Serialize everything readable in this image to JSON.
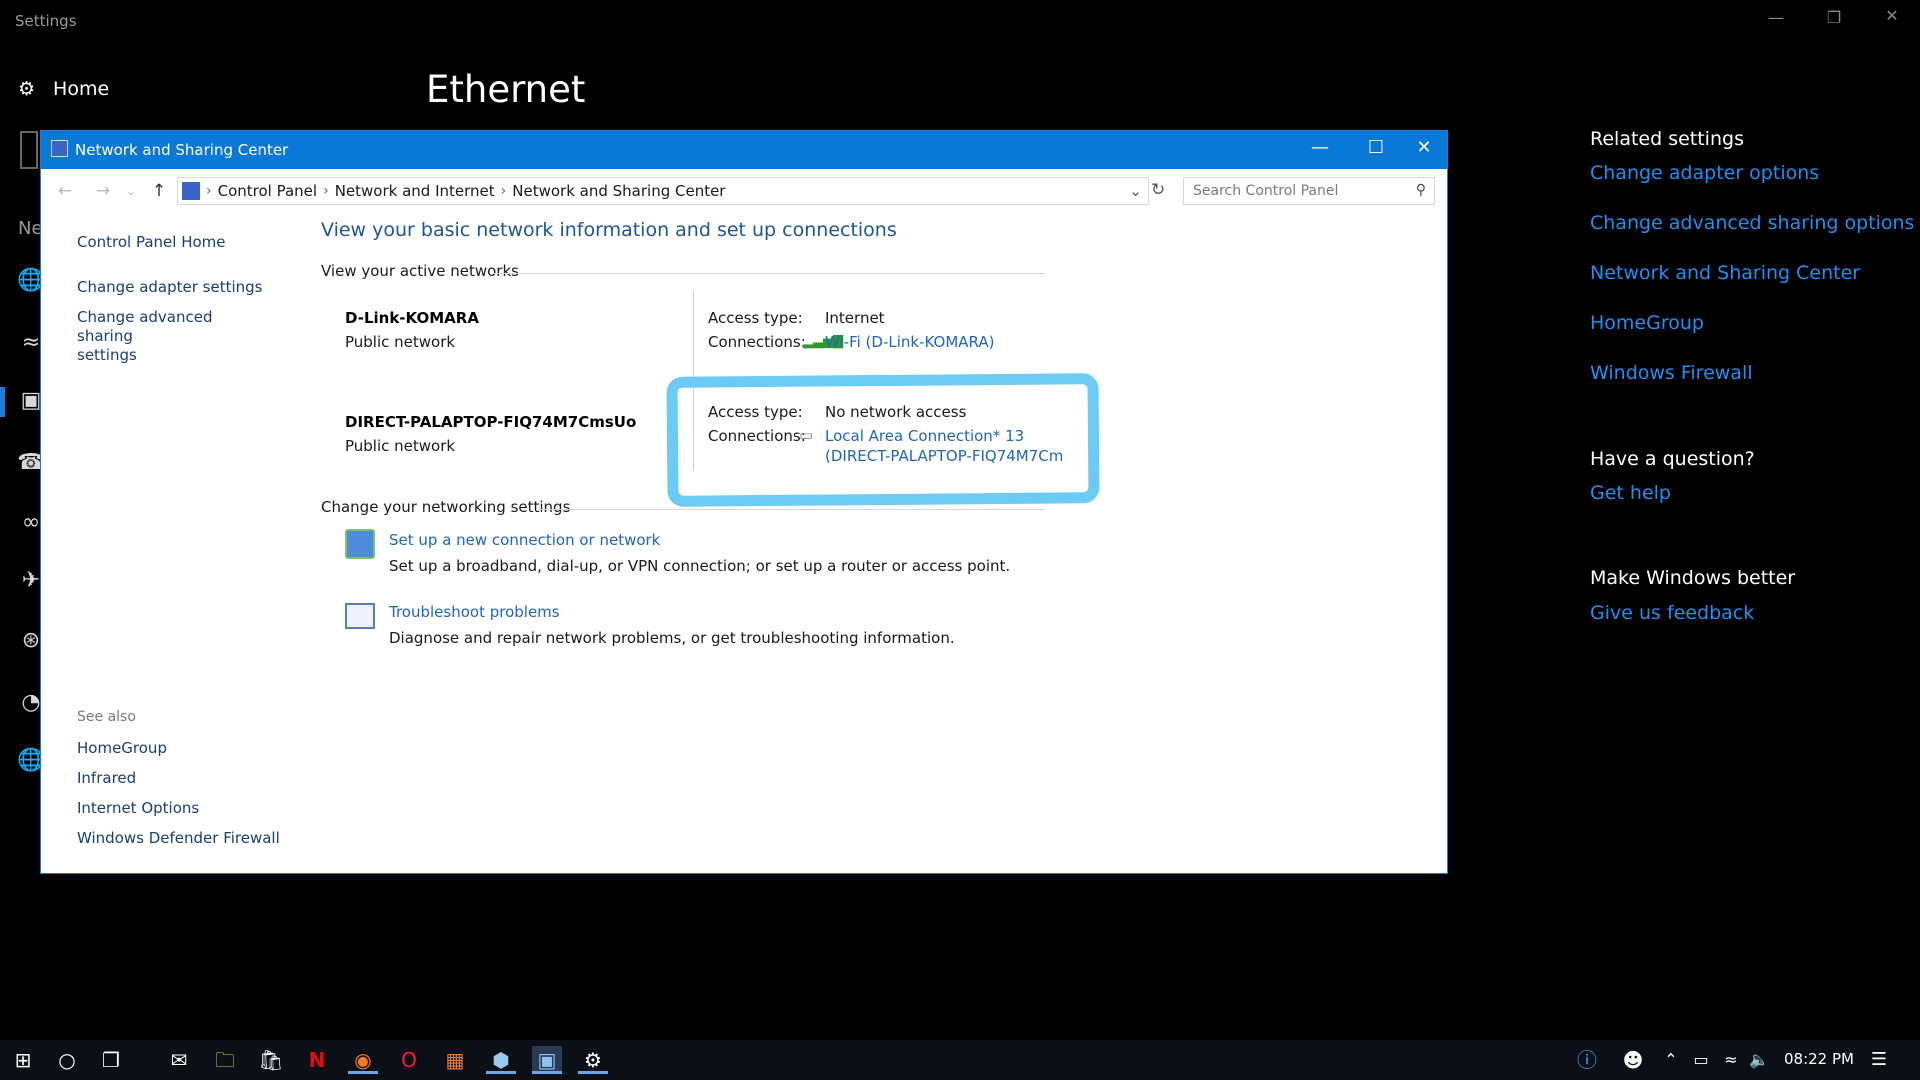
{
  "settings": {
    "window_title": "Settings",
    "home_label": "Home",
    "page_title": "Ethernet",
    "section_stub": "Ne",
    "related": {
      "heading": "Related settings",
      "links": [
        "Change adapter options",
        "Change advanced sharing options",
        "Network and Sharing Center",
        "HomeGroup",
        "Windows Firewall"
      ]
    },
    "question": {
      "heading": "Have a question?",
      "link": "Get help"
    },
    "feedback": {
      "heading": "Make Windows better",
      "link": "Give us feedback"
    }
  },
  "control_panel": {
    "window_title": "Network and Sharing Center",
    "breadcrumbs": [
      "Control Panel",
      "Network and Internet",
      "Network and Sharing Center"
    ],
    "search_placeholder": "Search Control Panel",
    "left_links": [
      "Control Panel Home",
      "Change adapter settings",
      "Change advanced sharing\nsettings"
    ],
    "see_also": {
      "heading": "See also",
      "links": [
        "HomeGroup",
        "Infrared",
        "Internet Options",
        "Windows Defender Firewall"
      ]
    },
    "heading": "View your basic network information and set up connections",
    "active_networks_title": "View your active networks",
    "networks": [
      {
        "name": "D-Link-KOMARA",
        "type": "Public network",
        "access_label": "Access type:",
        "access_value": "Internet",
        "connections_label": "Connections:",
        "connection": "Wi-Fi (D-Link-KOMARA)",
        "connection_line2": ""
      },
      {
        "name": "DIRECT-PALAPTOP-FIQ74M7CmsUo",
        "type": "Public network",
        "access_label": "Access type:",
        "access_value": "No network access",
        "connections_label": "Connections:",
        "connection": "Local Area Connection* 13",
        "connection_line2": "(DIRECT-PALAPTOP-FIQ74M7Cm"
      }
    ],
    "change_settings_title": "Change your networking settings",
    "tasks": [
      {
        "link": "Set up a new connection or network",
        "desc": "Set up a broadband, dial-up, or VPN connection; or set up a router or access point."
      },
      {
        "link": "Troubleshoot problems",
        "desc": "Diagnose and repair network problems, or get troubleshooting information."
      }
    ]
  },
  "taskbar": {
    "clock": "08:22 PM"
  },
  "colors": {
    "accent": "#0a78d7",
    "link": "#1f8ff0",
    "highlight": "#6ccbf4"
  }
}
